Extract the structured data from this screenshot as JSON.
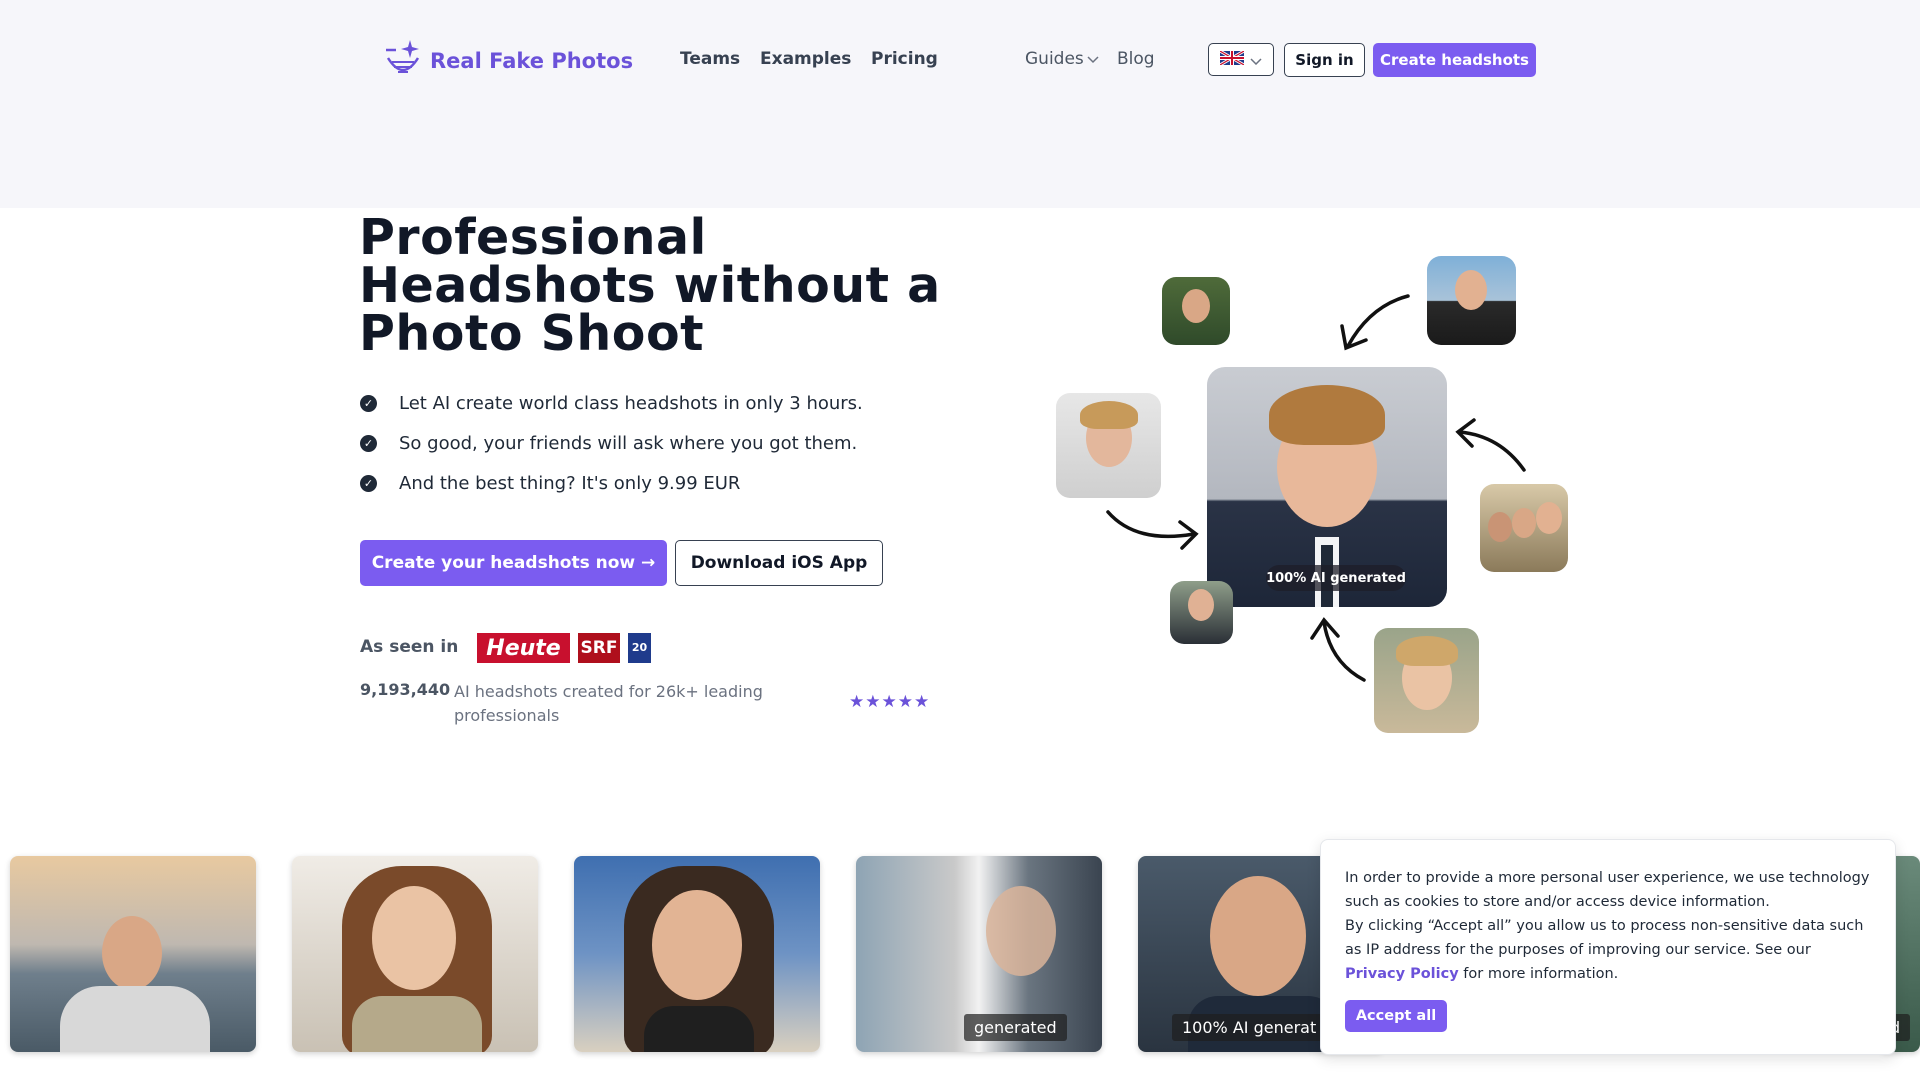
{
  "nav": {
    "brand": "Real Fake Photos",
    "links": [
      "Teams",
      "Examples",
      "Pricing"
    ],
    "guides": "Guides",
    "blog": "Blog",
    "signin": "Sign in",
    "create": "Create headshots"
  },
  "hero": {
    "title": "Professional Headshots without a Photo Shoot",
    "bullets": [
      "Let AI create world class headshots in only 3 hours.",
      "So good, your friends will ask where you got them.",
      "And the best thing? It's only 9.99 EUR"
    ],
    "cta_primary": "Create your headshots now →",
    "cta_secondary": "Download iOS App",
    "seen_in": "As seen in",
    "press": [
      "Heute",
      "SRF",
      "20"
    ],
    "count": "9,193,440",
    "count_desc": "AI headshots created for 26k+ leading professionals",
    "stars": "★★★★★",
    "ai_badge": "100% AI generated"
  },
  "gallery": {
    "tags": [
      "generated",
      "100% AI generat",
      "d"
    ]
  },
  "cookie": {
    "text1": "In order to provide a more personal user experience, we use technology such as cookies to store and/or access device information.",
    "text2": "By clicking “Accept all” you allow us to process non-sensitive data such as IP address for the purposes of improving our service. See our",
    "link": "Privacy Policy",
    "text3": "for more information.",
    "accept": "Accept all"
  },
  "colors": {
    "accent": "#7b5cf0",
    "brand": "#6b52d9",
    "dark": "#111827"
  }
}
